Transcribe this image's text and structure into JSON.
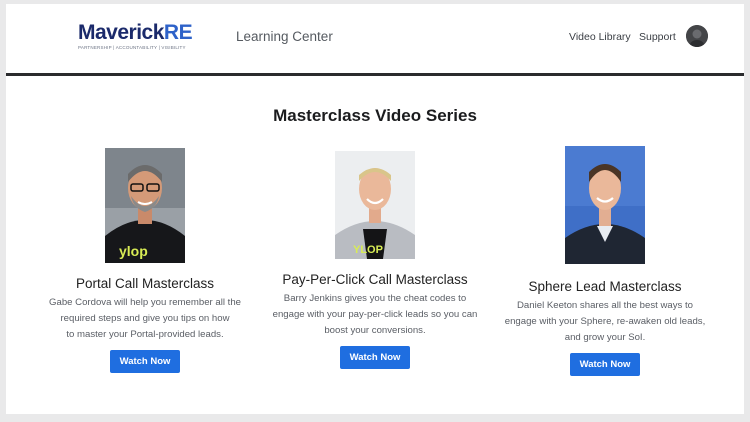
{
  "header": {
    "logo_main": "Maverick",
    "logo_accent": "RE",
    "logo_tagline": "PARTNERSHIP | ACCOUNTABILITY | VISIBILITY",
    "title": "Learning Center",
    "nav": [
      "Video Library",
      "Support"
    ]
  },
  "main": {
    "title": "Masterclass Video Series",
    "cards": [
      {
        "title": "Portal Call Masterclass",
        "desc_lines": [
          "Gabe Cordova will help you remember all the",
          "required steps and give you tips on how",
          "to master your Portal-provided leads."
        ],
        "button": "Watch Now",
        "shirt_text": "ylop"
      },
      {
        "title": "Pay-Per-Click Call Masterclass",
        "desc_lines": [
          "Barry Jenkins gives you the cheat codes to",
          "engage with your pay-per-click leads so you can",
          "boost your conversions."
        ],
        "button": "Watch Now",
        "shirt_text": "YLOP"
      },
      {
        "title": "Sphere Lead Masterclass",
        "desc_lines": [
          "Daniel Keeton shares all the best ways to",
          "engage with your Sphere, re-awaken old leads,",
          "and grow your SoI."
        ],
        "button": "Watch Now"
      }
    ]
  },
  "colors": {
    "accent": "#1f6ee0",
    "brand_navy": "#1b2a6b",
    "brand_blue": "#2e62c9"
  }
}
